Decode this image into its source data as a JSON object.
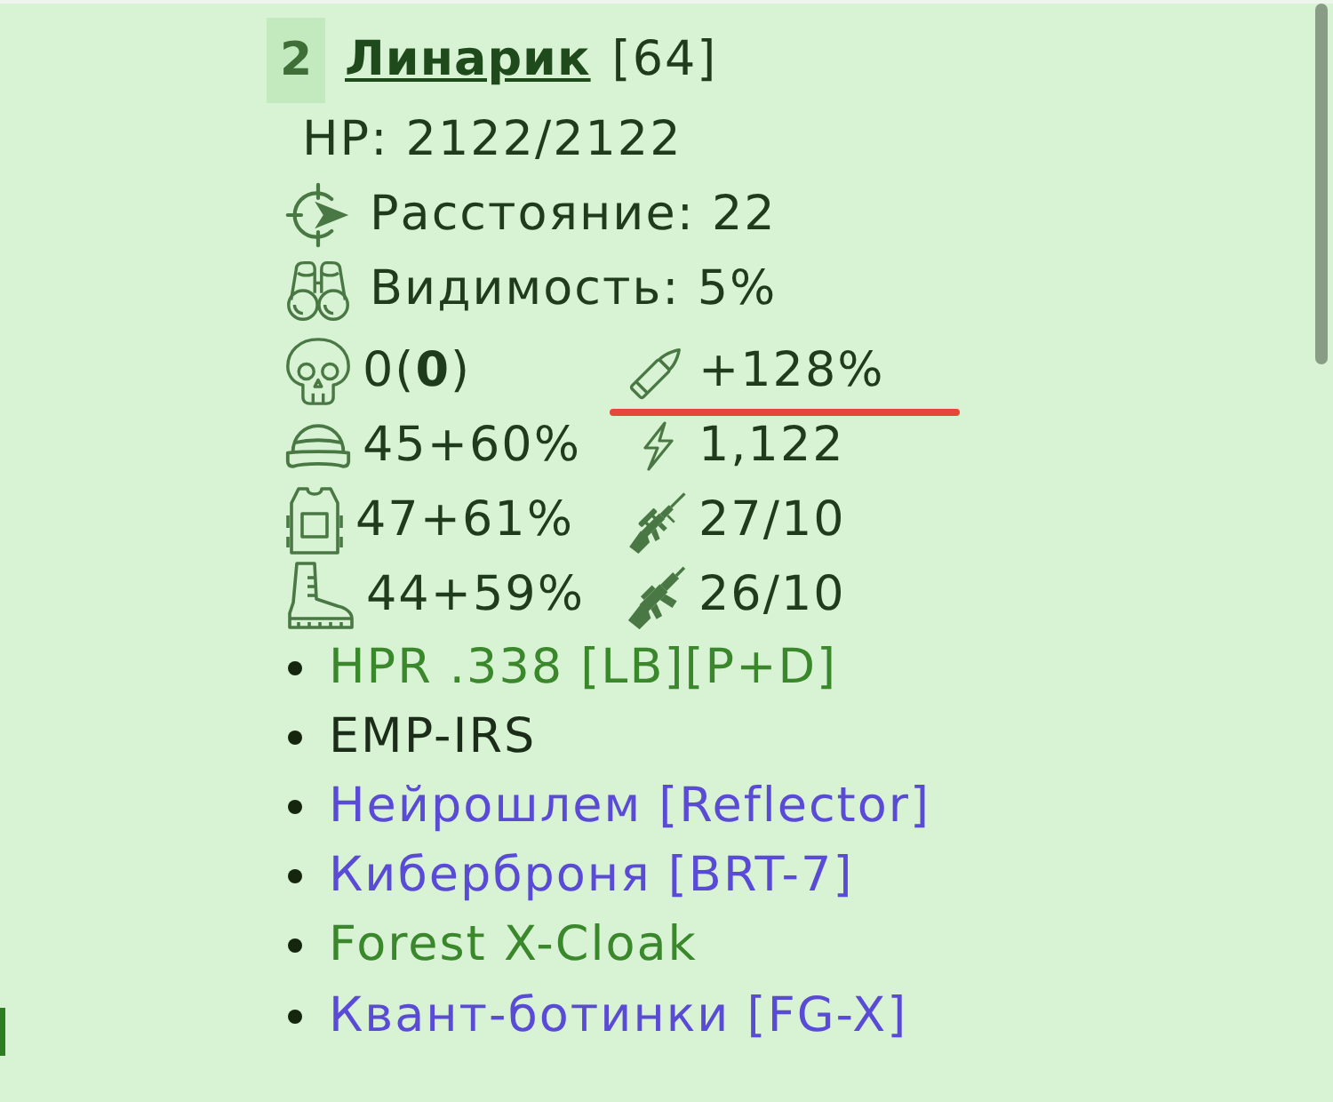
{
  "header": {
    "number": "2",
    "name": "Линарик",
    "rank": "[64]"
  },
  "hp": "HP: 2122/2122",
  "info_rows": [
    {
      "kind": "distance",
      "text": "Расстояние: 22"
    },
    {
      "kind": "visibility",
      "text": "Видимость: 5%"
    }
  ],
  "stat_rows": [
    {
      "left": {
        "kind": "skull",
        "text": "0(**0**)",
        "underlined": false
      },
      "right": {
        "kind": "bullet",
        "text": "+128%",
        "underlined": true
      }
    },
    {
      "left": {
        "kind": "helmet",
        "text": "45+60%",
        "underlined": false
      },
      "right": {
        "kind": "lightning",
        "text": "1,122",
        "underlined": false
      }
    },
    {
      "left": {
        "kind": "vest",
        "text": "47+61%",
        "underlined": false
      },
      "right": {
        "kind": "scoped_rifle",
        "text": "27/10",
        "underlined": false
      }
    },
    {
      "left": {
        "kind": "boot",
        "text": "44+59%",
        "underlined": false
      },
      "right": {
        "kind": "rifle",
        "text": "26/10",
        "underlined": false
      }
    }
  ],
  "equipment": [
    {
      "text": "HPR .338 [LB][P+D]",
      "color": "#3a872c"
    },
    {
      "text": "EMP-IRS",
      "color": "#1b2c19"
    },
    {
      "text": "Нейрошлем [Reflector]",
      "color": "#5a4bd6"
    },
    {
      "text": "Киберброня [BRT-7]",
      "color": "#5a4bd6"
    },
    {
      "text": "Forest X-Cloak",
      "color": "#3a872c"
    },
    {
      "text": "Квант-ботинки [FG-X]",
      "color": "#5a4bd6"
    }
  ]
}
